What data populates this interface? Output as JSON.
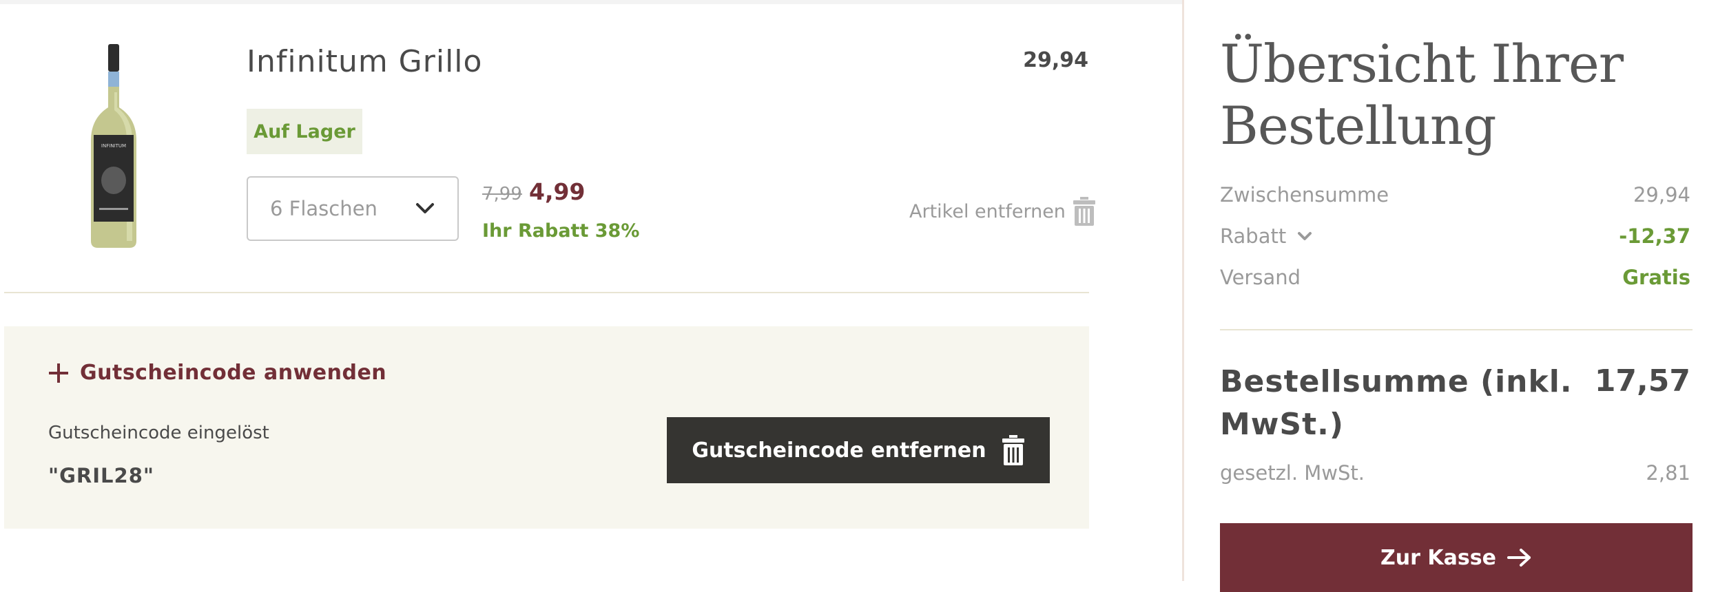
{
  "cart_item": {
    "name": "Infinitum Grillo",
    "line_total": "29,94",
    "stock_status": "Auf Lager",
    "quantity_selected": "6 Flaschen",
    "old_price": "7,99",
    "new_price": "4,99",
    "discount_text": "Ihr Rabatt 38%",
    "remove_label": "Artikel entfernen",
    "bottle_label": "INFINITUM"
  },
  "coupon": {
    "toggle_label": "Gutscheincode anwenden",
    "applied_label": "Gutscheincode eingelöst",
    "code": "\"GRIL28\"",
    "remove_button_label": "Gutscheincode entfernen"
  },
  "summary": {
    "title_line1": "Übersicht Ihrer",
    "title_line2": "Bestellung",
    "subtotal_label": "Zwischensumme",
    "subtotal_value": "29,94",
    "discount_label": "Rabatt",
    "discount_value": "-12,37",
    "shipping_label": "Versand",
    "shipping_value": "Gratis",
    "total_label": "Bestellsumme (inkl. MwSt.)",
    "total_value": "17,57",
    "vat_label": "gesetzl. MwSt.",
    "vat_value": "2,81",
    "checkout_label": "Zur Kasse"
  },
  "colors": {
    "accent": "#722f37",
    "positive": "#6a9a36",
    "dark_button": "#353431",
    "coupon_bg": "#f7f6ee"
  },
  "icons": {
    "quantity_dropdown": "chevron-down-icon",
    "remove_item": "trash-icon",
    "coupon_toggle": "plus-icon",
    "coupon_remove": "trash-icon",
    "discount_expand": "chevron-down-icon",
    "checkout": "arrow-right-icon"
  }
}
